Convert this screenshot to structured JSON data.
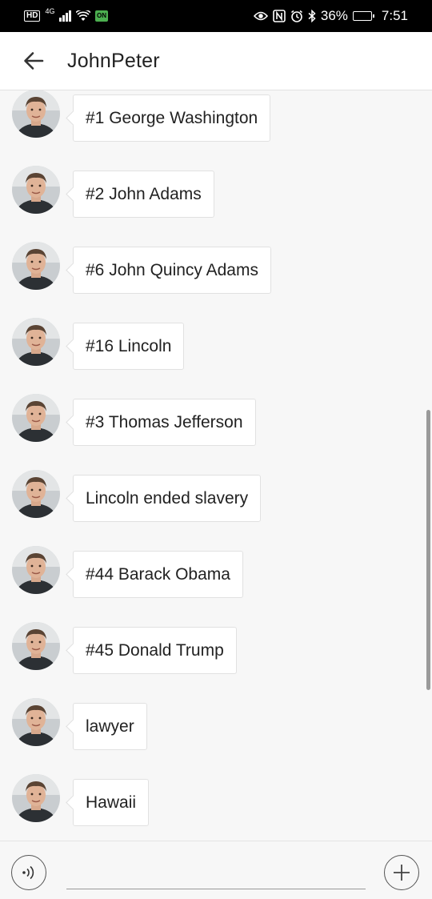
{
  "status_bar": {
    "hd": "HD",
    "network": "4G",
    "sim_label": "ON",
    "battery": "36%",
    "time": "7:51",
    "battery_level": 0.36,
    "icons": [
      "hd-icon",
      "signal-icon",
      "wifi-icon",
      "sim-icon",
      "eye-icon",
      "nfc-icon",
      "alarm-icon",
      "bluetooth-icon",
      "battery-icon"
    ]
  },
  "header": {
    "title": "JohnPeter",
    "back_icon": "arrow-left-icon"
  },
  "messages": [
    {
      "text": "#1 George Washington"
    },
    {
      "text": "#2 John Adams"
    },
    {
      "text": "#6 John Quincy Adams"
    },
    {
      "text": "#16 Lincoln"
    },
    {
      "text": "#3 Thomas Jefferson"
    },
    {
      "text": "Lincoln ended slavery"
    },
    {
      "text": "#44 Barack Obama"
    },
    {
      "text": "#45 Donald Trump"
    },
    {
      "text": "lawyer"
    },
    {
      "text": "Hawaii"
    }
  ],
  "input_bar": {
    "value": "",
    "voice_icon": "voice-icon",
    "plus_icon": "plus-icon"
  },
  "colors": {
    "background": "#f7f7f7",
    "bubble": "#ffffff",
    "status_bar": "#000000",
    "text": "#222222"
  }
}
